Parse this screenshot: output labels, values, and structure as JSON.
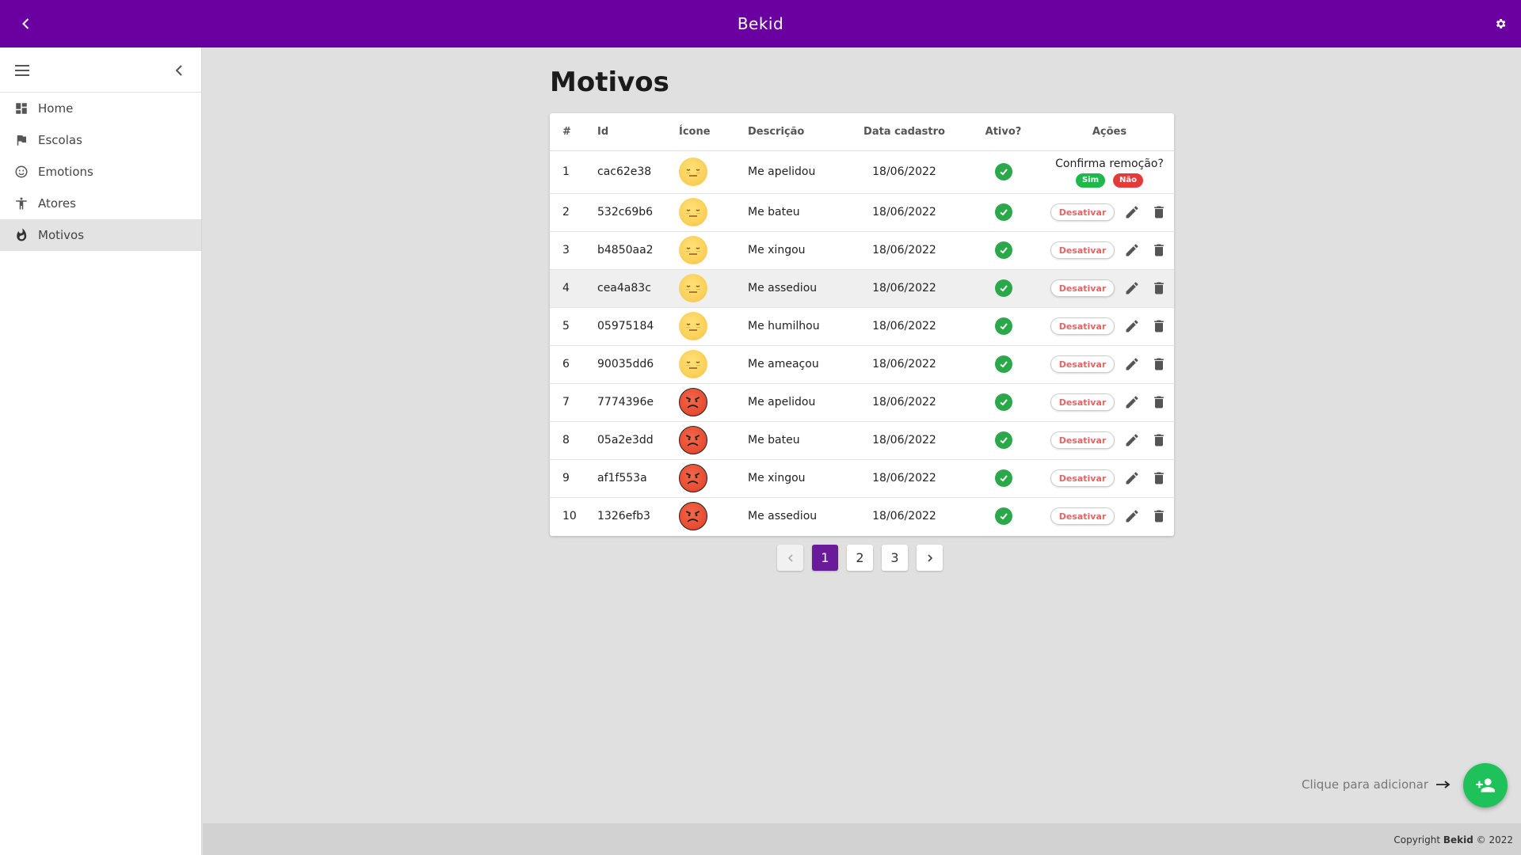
{
  "app": {
    "title": "Bekid"
  },
  "sidebar": {
    "items": [
      {
        "label": "Home",
        "icon": "dashboard-icon"
      },
      {
        "label": "Escolas",
        "icon": "flag-icon"
      },
      {
        "label": "Emotions",
        "icon": "smiley-icon"
      },
      {
        "label": "Atores",
        "icon": "person-icon"
      },
      {
        "label": "Motivos",
        "icon": "flame-icon",
        "active": true
      }
    ]
  },
  "page": {
    "title": "Motivos"
  },
  "table": {
    "headers": {
      "num": "#",
      "id": "Id",
      "icon": "Ícone",
      "desc": "Descrição",
      "date": "Data cadastro",
      "active": "Ativo?",
      "actions": "Ações"
    },
    "rows": [
      {
        "num": "1",
        "id": "cac62e38",
        "emoji": "meh",
        "desc": "Me apelidou",
        "date": "18/06/2022"
      },
      {
        "num": "2",
        "id": "532c69b6",
        "emoji": "meh",
        "desc": "Me bateu",
        "date": "18/06/2022"
      },
      {
        "num": "3",
        "id": "b4850aa2",
        "emoji": "meh",
        "desc": "Me xingou",
        "date": "18/06/2022"
      },
      {
        "num": "4",
        "id": "cea4a83c",
        "emoji": "meh",
        "desc": "Me assediou",
        "date": "18/06/2022"
      },
      {
        "num": "5",
        "id": "05975184",
        "emoji": "meh",
        "desc": "Me humilhou",
        "date": "18/06/2022"
      },
      {
        "num": "6",
        "id": "90035dd6",
        "emoji": "meh",
        "desc": "Me ameaçou",
        "date": "18/06/2022"
      },
      {
        "num": "7",
        "id": "7774396e",
        "emoji": "angry",
        "desc": "Me apelidou",
        "date": "18/06/2022"
      },
      {
        "num": "8",
        "id": "05a2e3dd",
        "emoji": "angry",
        "desc": "Me bateu",
        "date": "18/06/2022"
      },
      {
        "num": "9",
        "id": "af1f553a",
        "emoji": "angry",
        "desc": "Me xingou",
        "date": "18/06/2022"
      },
      {
        "num": "10",
        "id": "1326efb3",
        "emoji": "angry",
        "desc": "Me assediou",
        "date": "18/06/2022"
      }
    ],
    "deactivate_label": "Desativar",
    "confirm": {
      "question": "Confirma remoção?",
      "yes": "Sim",
      "no": "Não"
    }
  },
  "pagination": {
    "pages": [
      "1",
      "2",
      "3"
    ],
    "current": "1"
  },
  "add_hint": "Clique para adicionar",
  "footer": {
    "prefix": "Copyright ",
    "brand": "Bekid",
    "suffix": " © 2022"
  },
  "colors": {
    "topbar": "#6a00a0",
    "active_page": "#6a1b9a",
    "fab": "#1fc15a",
    "check": "#2aa84a",
    "yes": "#1fb84b",
    "no": "#e53a3a"
  }
}
